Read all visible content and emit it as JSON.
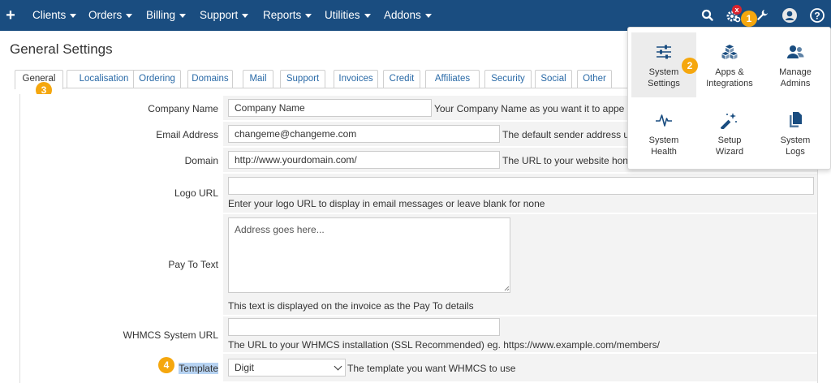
{
  "topbar": {
    "nav": [
      {
        "label": "Clients"
      },
      {
        "label": "Orders"
      },
      {
        "label": "Billing"
      },
      {
        "label": "Support"
      },
      {
        "label": "Reports"
      },
      {
        "label": "Utilities"
      },
      {
        "label": "Addons"
      }
    ],
    "icons": [
      "plus-icon",
      "search-icon",
      "gear-icon",
      "wrench-icon",
      "user-icon",
      "help-icon"
    ],
    "notification_badge": "x",
    "callouts": {
      "c1": "1",
      "c2": "2",
      "c3": "3",
      "c4": "4"
    },
    "bar_color": "#1a4d80",
    "callout_color": "#f5a70e"
  },
  "page": {
    "title": "General Settings",
    "tabs": [
      {
        "label": "General"
      },
      {
        "label": "Localisation"
      },
      {
        "label": "Ordering"
      },
      {
        "label": "Domains"
      },
      {
        "label": "Mail"
      },
      {
        "label": "Support"
      },
      {
        "label": "Invoices"
      },
      {
        "label": "Credit"
      },
      {
        "label": "Affiliates"
      },
      {
        "label": "Security"
      },
      {
        "label": "Social"
      },
      {
        "label": "Other"
      }
    ]
  },
  "form": {
    "company_name": {
      "label": "Company Name",
      "value": "Company Name",
      "hint": "Your Company Name as you want it to appe"
    },
    "email_address": {
      "label": "Email Address",
      "value": "changeme@changeme.com",
      "hint": "The default sender address u"
    },
    "domain": {
      "label": "Domain",
      "value": "http://www.yourdomain.com/",
      "hint": "The URL to your website hon"
    },
    "logo_url": {
      "label": "Logo URL",
      "value": "",
      "hint": "Enter your logo URL to display in email messages or leave blank for none"
    },
    "pay_to_text": {
      "label": "Pay To Text",
      "placeholder": "Address goes here...",
      "hint": "This text is displayed on the invoice as the Pay To details"
    },
    "system_url": {
      "label": "WHMCS System URL",
      "value": "",
      "hint": "The URL to your WHMCS installation (SSL Recommended) eg. https://www.example.com/members/"
    },
    "template": {
      "label": "Template",
      "value": "Digit",
      "hint": "The template you want WHMCS to use"
    }
  },
  "dropdown": {
    "items": [
      {
        "line1": "System",
        "line2": "Settings",
        "icon": "sliders-icon"
      },
      {
        "line1": "Apps &",
        "line2": "Integrations",
        "icon": "cubes-icon"
      },
      {
        "line1": "Manage",
        "line2": "Admins",
        "icon": "users-icon"
      },
      {
        "line1": "System",
        "line2": "Health",
        "icon": "heartbeat-icon"
      },
      {
        "line1": "Setup",
        "line2": "Wizard",
        "icon": "magic-wand-icon"
      },
      {
        "line1": "System",
        "line2": "Logs",
        "icon": "files-icon"
      }
    ]
  }
}
